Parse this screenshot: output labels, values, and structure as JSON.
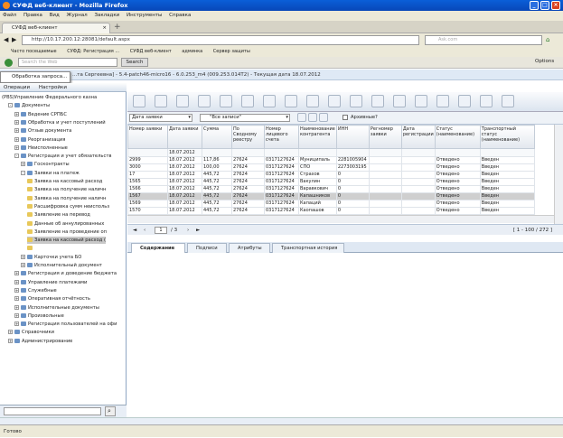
{
  "window": {
    "title": "СУФД веб-клиент - Mozilla Firefox"
  },
  "menu": [
    "Файл",
    "Правка",
    "Вид",
    "Журнал",
    "Закладки",
    "Инструменты",
    "Справка"
  ],
  "browser_tab": {
    "label": "СУФД веб-клиент"
  },
  "address": {
    "url": "http://10.17.200.12:28081/default.aspx"
  },
  "search_box": {
    "placeholder": "Ask.com"
  },
  "bookmarks": [
    "Часто посещаемые",
    "СУФД: Регистрация ...",
    "СУФД веб-клиент",
    "админка",
    "Сервер защиты"
  ],
  "ext_toolbar": {
    "search_placeholder": "Search the Web",
    "search_button": "Search",
    "options": "Options"
  },
  "status_line": "...та Сергеевна] - 5.4-patch46-micro16 - 6.0.253_m4 (009.253.014Т2) - Текущая дата 18.07.2012",
  "popup": "Обработка запроса...",
  "ops_menu": [
    "Операции",
    "Настройки"
  ],
  "tree": [
    {
      "label": "(PBS)Управление Федерального казна",
      "level": 0,
      "icon": "none",
      "exp": "",
      "sel": false
    },
    {
      "label": "Документы",
      "level": 1,
      "icon": "folder",
      "exp": "-",
      "sel": false
    },
    {
      "label": "Ведение СРПБС",
      "level": 2,
      "icon": "folder",
      "exp": "+",
      "sel": false
    },
    {
      "label": "Обработка и учет поступлений",
      "level": 2,
      "icon": "folder",
      "exp": "+",
      "sel": false
    },
    {
      "label": "Отзыв документа",
      "level": 2,
      "icon": "folder",
      "exp": "+",
      "sel": false
    },
    {
      "label": "Реорганизация",
      "level": 2,
      "icon": "folder",
      "exp": "+",
      "sel": false
    },
    {
      "label": "Неисполненные",
      "level": 2,
      "icon": "folder",
      "exp": "+",
      "sel": false
    },
    {
      "label": "Регистрация и учет обязательств",
      "level": 2,
      "icon": "folder",
      "exp": "-",
      "sel": false
    },
    {
      "label": "Госконтракты",
      "level": 3,
      "icon": "doc",
      "exp": "+",
      "sel": false
    },
    {
      "label": "Заявки на платеж",
      "level": 3,
      "icon": "doc",
      "exp": "-",
      "sel": false
    },
    {
      "label": "Заявка на кассовый расход",
      "level": 4,
      "icon": "file",
      "exp": "",
      "sel": false
    },
    {
      "label": "Заявка на получение наличн",
      "level": 4,
      "icon": "file",
      "exp": "",
      "sel": false
    },
    {
      "label": "Заявка на получение наличн",
      "level": 4,
      "icon": "file",
      "exp": "",
      "sel": false
    },
    {
      "label": "Расшифровка сумм неиспольз",
      "level": 4,
      "icon": "file",
      "exp": "",
      "sel": false
    },
    {
      "label": "Заявление на перевод",
      "level": 4,
      "icon": "file",
      "exp": "",
      "sel": false
    },
    {
      "label": "Данные об аннулированных",
      "level": 4,
      "icon": "file",
      "exp": "",
      "sel": false
    },
    {
      "label": "Заявление на проведение оп",
      "level": 4,
      "icon": "file",
      "exp": "",
      "sel": false
    },
    {
      "label": "Заявка на кассовый расход (",
      "level": 4,
      "icon": "file",
      "exp": "",
      "sel": true
    },
    {
      "label": "",
      "level": 4,
      "icon": "file",
      "exp": "",
      "sel": false
    },
    {
      "label": "Карточки учета БО",
      "level": 3,
      "icon": "doc",
      "exp": "+",
      "sel": false
    },
    {
      "label": "Исполнительный документ",
      "level": 3,
      "icon": "doc",
      "exp": "+",
      "sel": false
    },
    {
      "label": "Регистрация и доведение бюджета",
      "level": 2,
      "icon": "folder",
      "exp": "+",
      "sel": false
    },
    {
      "label": "Управление платежами",
      "level": 2,
      "icon": "folder",
      "exp": "+",
      "sel": false
    },
    {
      "label": "Служебные",
      "level": 2,
      "icon": "folder",
      "exp": "+",
      "sel": false
    },
    {
      "label": "Оперативная отчётность",
      "level": 2,
      "icon": "folder",
      "exp": "+",
      "sel": false
    },
    {
      "label": "Исполнительные документы",
      "level": 2,
      "icon": "folder",
      "exp": "+",
      "sel": false
    },
    {
      "label": "Произвольные",
      "level": 2,
      "icon": "folder",
      "exp": "+",
      "sel": false
    },
    {
      "label": "Регистрация пользователей на офи",
      "level": 2,
      "icon": "folder",
      "exp": "+",
      "sel": false
    },
    {
      "label": "Справочники",
      "level": 1,
      "icon": "folder",
      "exp": "+",
      "sel": false
    },
    {
      "label": "Администрирование",
      "level": 1,
      "icon": "folder",
      "exp": "+",
      "sel": false
    }
  ],
  "filter": {
    "field": "Дата заявки",
    "value": "\"Все записи\"",
    "archive_label": "Архивные?"
  },
  "grid": {
    "columns": [
      "Номер заявки",
      "Дата заявки",
      "Сумма",
      "По Сводному реестру",
      "Номер лицевого счета",
      "Наименование контрагента",
      "ИНН",
      "Регномер заявки",
      "Дата регистрации",
      "Статус (наименование)",
      "Транспортный статус (наименование)"
    ],
    "filter_row": [
      "",
      "18.07.2012",
      "",
      "",
      "",
      "",
      "",
      "",
      "",
      "",
      ""
    ],
    "rows": [
      [
        "2999",
        "18.07.2012",
        "117,86",
        "27624",
        "0317127624",
        "Муниципаль",
        "2281005904",
        "",
        "",
        "Отведено",
        "Введен"
      ],
      [
        "3000",
        "18.07.2012",
        "100,00",
        "27624",
        "0317127624",
        "СПО",
        "2273003195",
        "",
        "",
        "Отведено",
        "Введен"
      ],
      [
        "17",
        "18.07.2012",
        "445,72",
        "27624",
        "0317127624",
        "Страхов",
        "0",
        "",
        "",
        "Отведено",
        "Введен"
      ],
      [
        "1565",
        "18.07.2012",
        "445,72",
        "27624",
        "0317127624",
        "Вакулин",
        "0",
        "",
        "",
        "Отведено",
        "Введен"
      ],
      [
        "1566",
        "18.07.2012",
        "445,72",
        "27624",
        "0317127624",
        "Варавкович",
        "0",
        "",
        "",
        "Отведено",
        "Введен"
      ],
      [
        "1567",
        "18.07.2012",
        "445,72",
        "27624",
        "0317127624",
        "Капашников",
        "0",
        "",
        "",
        "Отведено",
        "Введен"
      ],
      [
        "1569",
        "18.07.2012",
        "445,72",
        "27624",
        "0317127624",
        "Капаций",
        "0",
        "",
        "",
        "Отведено",
        "Введен"
      ],
      [
        "1570",
        "18.07.2012",
        "445,72",
        "27624",
        "0317127624",
        "Каопашов",
        "0",
        "",
        "",
        "Отведено",
        "Введен"
      ]
    ],
    "highlight_row": 5
  },
  "pager": {
    "page": "1",
    "of": "/ 3",
    "range": "[ 1 - 100 / 272 ]"
  },
  "detail_tabs": [
    "Содержание",
    "Подписи",
    "Атрибуты",
    "Транспортная история"
  ],
  "statusbar": {
    "text": "Готово"
  }
}
